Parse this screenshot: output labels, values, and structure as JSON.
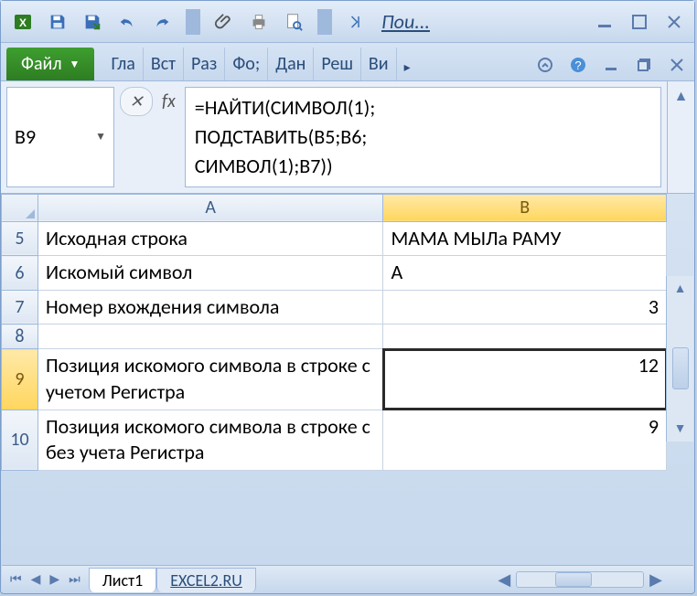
{
  "qat": {
    "search_label": "Пои..."
  },
  "ribbon": {
    "file": "Файл",
    "tabs": [
      "Гла",
      "Вст",
      "Раз",
      "Фо;",
      "Дан",
      "Реш",
      "Ви"
    ]
  },
  "name_box": "B9",
  "fx_label": "fx",
  "formula": "=НАЙТИ(СИМВОЛ(1);\nПОДСТАВИТЬ(B5;B6;\nСИМВОЛ(1);B7))",
  "columns": [
    "A",
    "B"
  ],
  "rows": [
    {
      "n": "5",
      "a": "Исходная строка",
      "b": "МАМА МЫЛа РАМУ",
      "a_num": false,
      "b_num": false
    },
    {
      "n": "6",
      "a": "Искомый символ",
      "b": "А",
      "a_num": false,
      "b_num": false
    },
    {
      "n": "7",
      "a": "Номер вхождения символа",
      "b": "3",
      "a_num": false,
      "b_num": true
    },
    {
      "n": "8",
      "a": "",
      "b": "",
      "a_num": false,
      "b_num": false
    },
    {
      "n": "9",
      "a": "Позиция искомого символа в строке с учетом Регистра",
      "b": "12",
      "a_num": false,
      "b_num": true,
      "sel": true
    },
    {
      "n": "10",
      "a": "Позиция искомого символа в строке с без учета Регистра",
      "b": "9",
      "a_num": false,
      "b_num": true
    }
  ],
  "sheets": {
    "active": "Лист1",
    "other": "EXCEL2.RU"
  }
}
